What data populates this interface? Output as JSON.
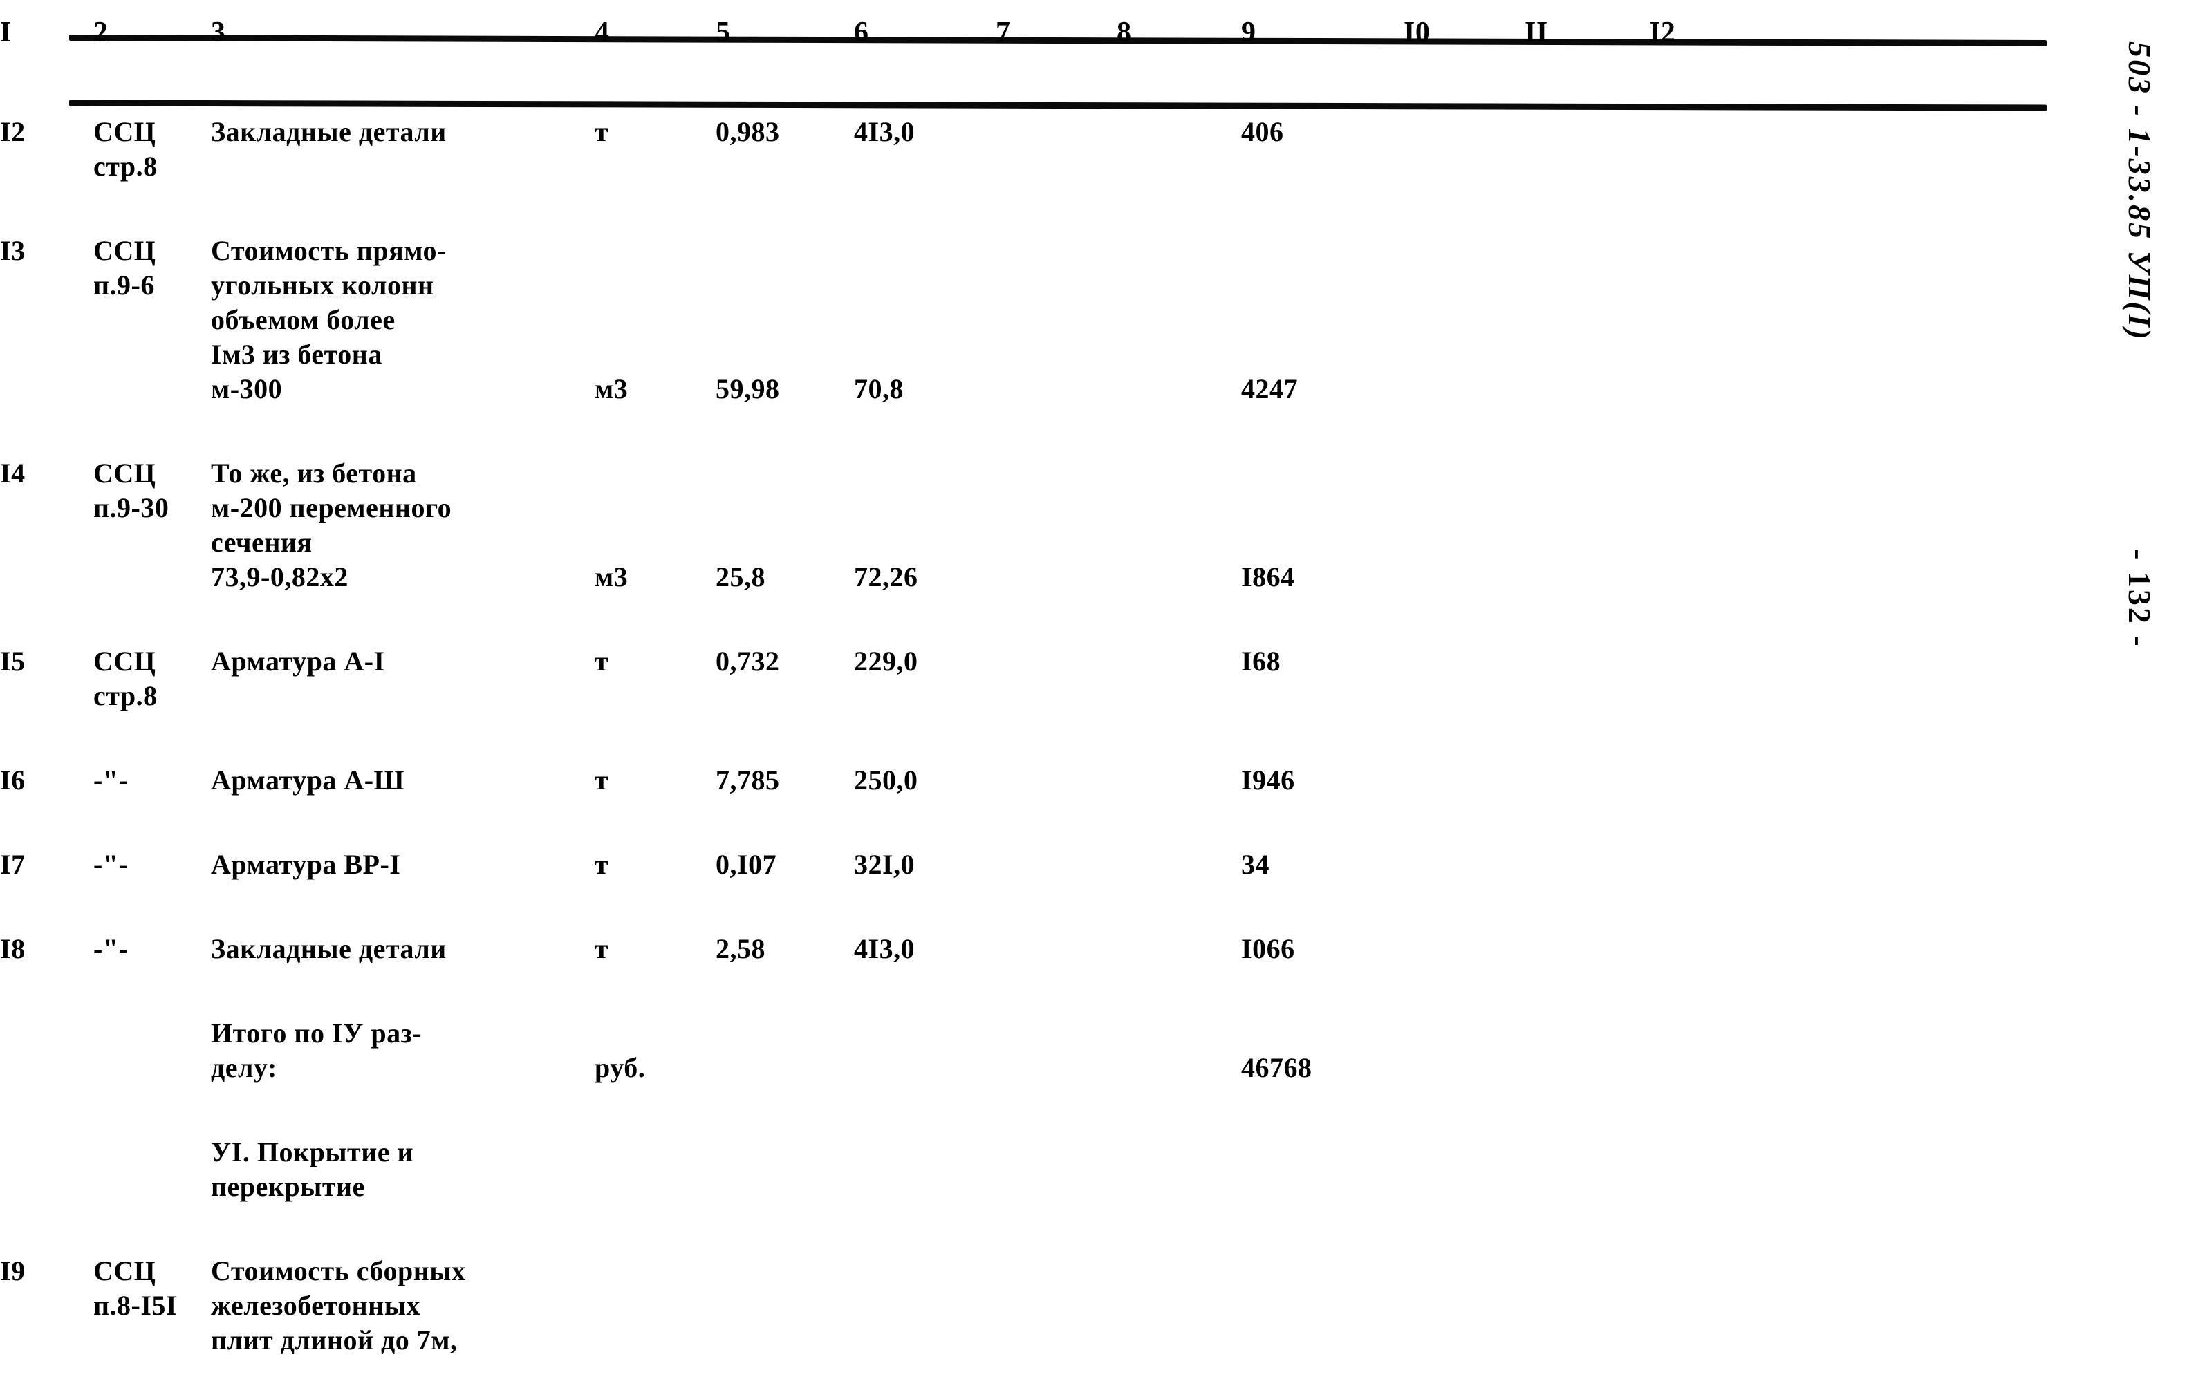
{
  "page": {
    "running_head_code": "503 - 1-33.85 УП(I)",
    "running_head_page": "- 132 -"
  },
  "table": {
    "column_headers": [
      "I",
      "2",
      "3",
      "4",
      "5",
      "6",
      "7",
      "8",
      "9",
      "I0",
      "II",
      "I2"
    ],
    "rows": [
      {
        "c1": "I2",
        "c2": "ССЦ\nстр.8",
        "c3": "Закладные детали",
        "c4": "т",
        "c5": "0,983",
        "c6": "4I3,0",
        "c7": "",
        "c8": "",
        "c9": "406",
        "c10": "",
        "c11": "",
        "c12": ""
      },
      {
        "c1": "I3",
        "c2": "ССЦ\nп.9-6",
        "c3": "Стоимость прямо-\nугольных колонн\nобъемом более\nIм3 из бетона\nм-300",
        "c4": "\n\n\n\nм3",
        "c5": "\n\n\n\n59,98",
        "c6": "\n\n\n\n70,8",
        "c7": "",
        "c8": "",
        "c9": "\n\n\n\n4247",
        "c10": "",
        "c11": "",
        "c12": ""
      },
      {
        "c1": "I4",
        "c2": "ССЦ\nп.9-30",
        "c3": "То же, из бетона\nм-200 переменного\nсечения\n73,9-0,82х2",
        "c4": "\n\n\nм3",
        "c5": "\n\n\n25,8",
        "c6": "\n\n\n72,26",
        "c7": "",
        "c8": "",
        "c9": "\n\n\nI864",
        "c10": "",
        "c11": "",
        "c12": ""
      },
      {
        "c1": "I5",
        "c2": "ССЦ\nстр.8",
        "c3": "Арматура А-I",
        "c4": "т",
        "c5": "0,732",
        "c6": "229,0",
        "c7": "",
        "c8": "",
        "c9": "I68",
        "c10": "",
        "c11": "",
        "c12": ""
      },
      {
        "c1": "I6",
        "c2": "-\"-",
        "c3": "Арматура А-Ш",
        "c4": "т",
        "c5": "7,785",
        "c6": "250,0",
        "c7": "",
        "c8": "",
        "c9": "I946",
        "c10": "",
        "c11": "",
        "c12": ""
      },
      {
        "c1": "I7",
        "c2": "-\"-",
        "c3": "Арматура ВР-I",
        "c4": "т",
        "c5": "0,I07",
        "c6": "32I,0",
        "c7": "",
        "c8": "",
        "c9": "34",
        "c10": "",
        "c11": "",
        "c12": ""
      },
      {
        "c1": "I8",
        "c2": "-\"-",
        "c3": "Закладные детали",
        "c4": "т",
        "c5": "2,58",
        "c6": "4I3,0",
        "c7": "",
        "c8": "",
        "c9": "I066",
        "c10": "",
        "c11": "",
        "c12": ""
      },
      {
        "c1": "",
        "c2": "",
        "c3": "Итого по IУ раз-\nделу:",
        "c4": "\nруб.",
        "c5": "",
        "c6": "",
        "c7": "",
        "c8": "",
        "c9": "\n46768",
        "c10": "",
        "c11": "",
        "c12": ""
      },
      {
        "c1": "",
        "c2": "",
        "c3": "УI. Покрытие и\n      перекрытие",
        "c4": "",
        "c5": "",
        "c6": "",
        "c7": "",
        "c8": "",
        "c9": "",
        "c10": "",
        "c11": "",
        "c12": ""
      },
      {
        "c1": "I9",
        "c2": "ССЦ\nп.8-I5I",
        "c3": "Стоимость сборных\nжелезобетонных\nплит длиной до 7м,",
        "c4": "",
        "c5": "",
        "c6": "",
        "c7": "",
        "c8": "",
        "c9": "",
        "c10": "",
        "c11": "",
        "c12": ""
      }
    ]
  }
}
